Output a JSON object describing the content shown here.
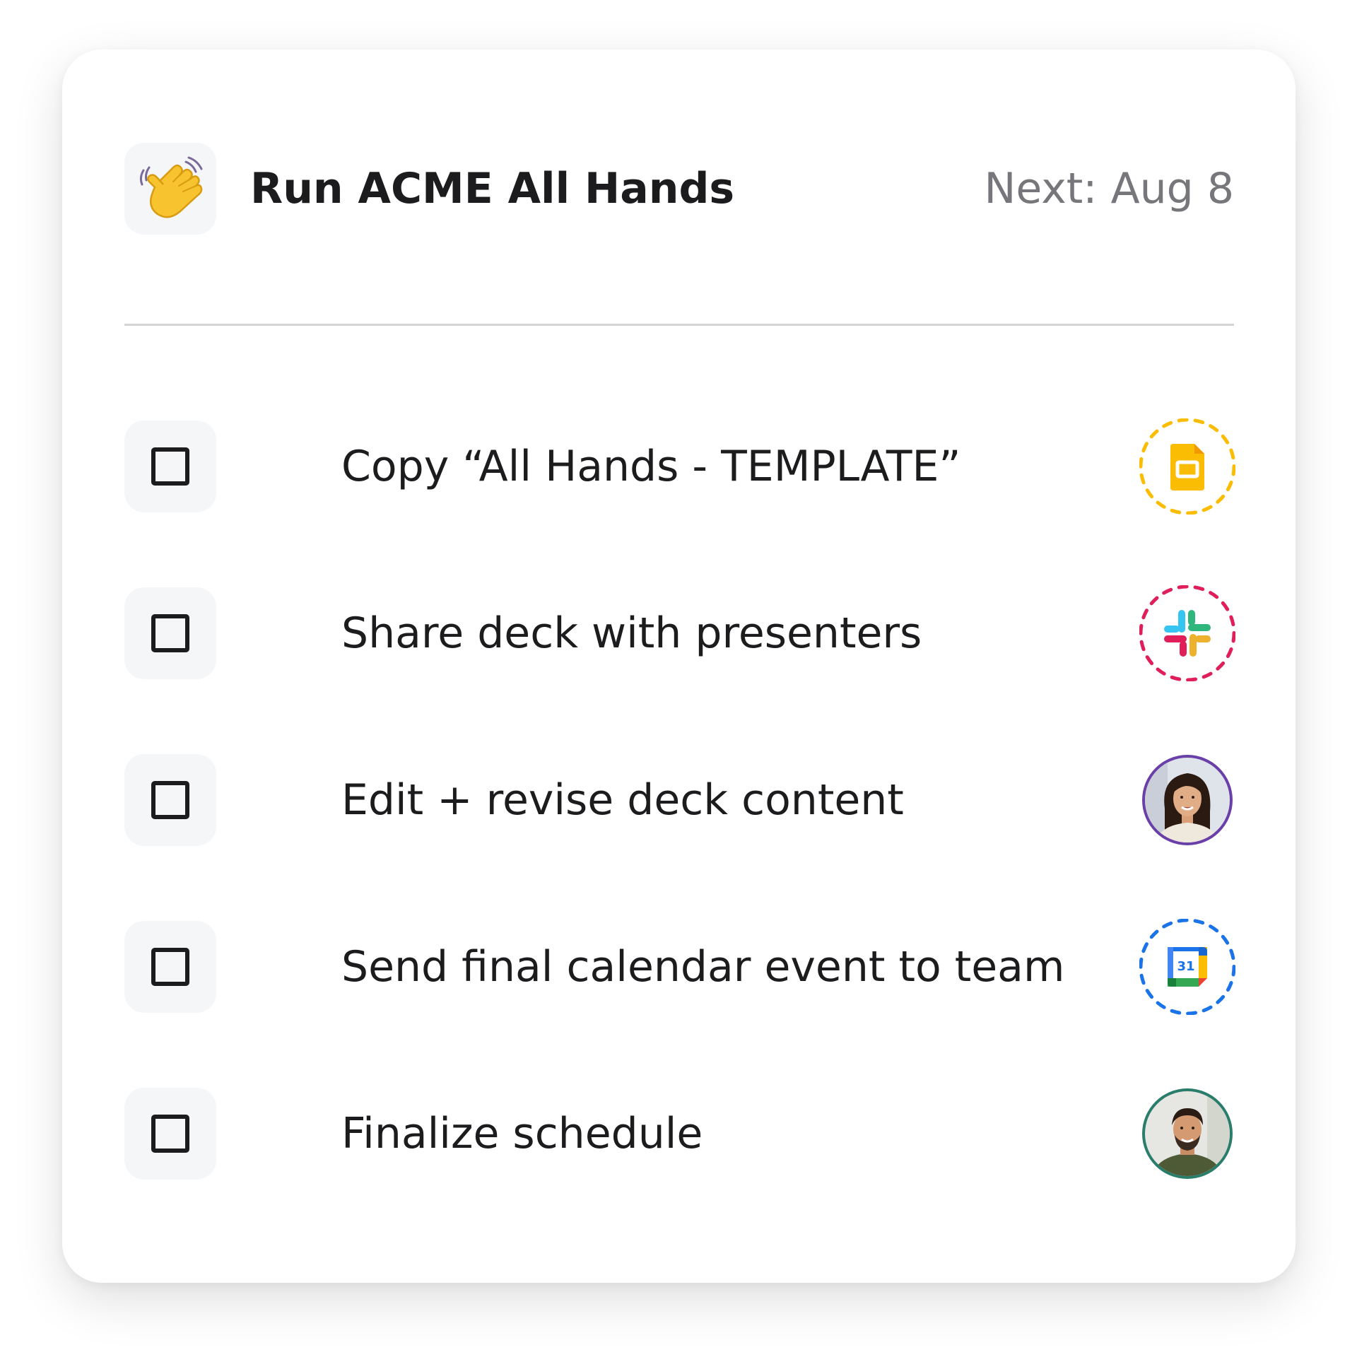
{
  "header": {
    "icon": "waving-hand-icon",
    "title": "Run ACME All Hands",
    "next_label": "Next: Aug 8"
  },
  "colors": {
    "slides_yellow": "#FBBC04",
    "slack_pink": "#E01E5A",
    "calendar_blue": "#1A73E8",
    "avatar_purple": "#6B3FA8",
    "avatar_teal": "#2A7D6B"
  },
  "tasks": [
    {
      "label": "Copy “All Hands - TEMPLATE”",
      "checked": false,
      "assignee": "google-slides-icon"
    },
    {
      "label": "Share deck with presenters",
      "checked": false,
      "assignee": "slack-icon"
    },
    {
      "label": "Edit + revise deck content",
      "checked": false,
      "assignee": "woman-avatar"
    },
    {
      "label": "Send final calendar event to team",
      "checked": false,
      "assignee": "google-calendar-icon",
      "calendar_day": "31"
    },
    {
      "label": "Finalize schedule",
      "checked": false,
      "assignee": "man-avatar"
    }
  ]
}
